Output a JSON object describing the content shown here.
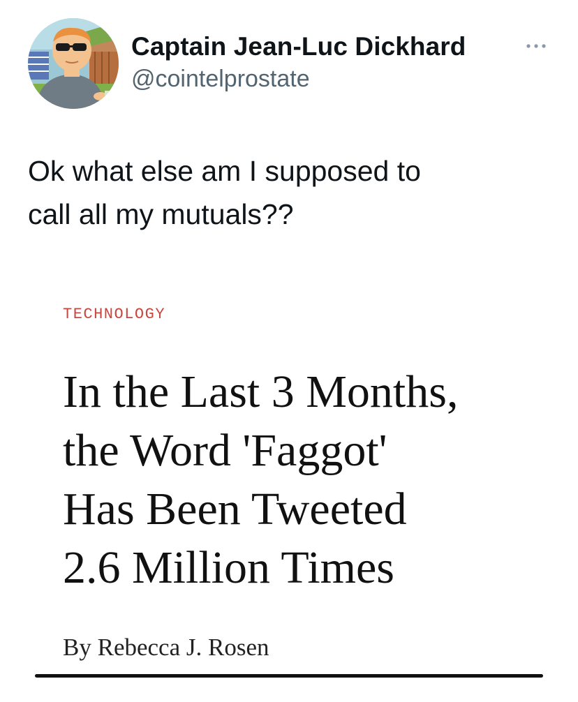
{
  "tweet": {
    "author": {
      "display_name": "Captain Jean-Luc Dickhard",
      "handle": "@cointelprostate"
    },
    "text_lines": [
      "Ok what else am I supposed to",
      "call all my mutuals??"
    ]
  },
  "article": {
    "section": "TECHNOLOGY",
    "headline_lines": [
      "In the Last 3 Months,",
      "the Word 'Faggot'",
      "Has Been Tweeted",
      "2.6 Million Times"
    ],
    "byline": "By Rebecca J. Rosen"
  },
  "colors": {
    "accent_red": "#c8473f",
    "handle_gray": "#536471",
    "text": "#0f1419"
  },
  "icons": {
    "avatar": "cartoon-avatar",
    "more": "more-options-icon"
  }
}
